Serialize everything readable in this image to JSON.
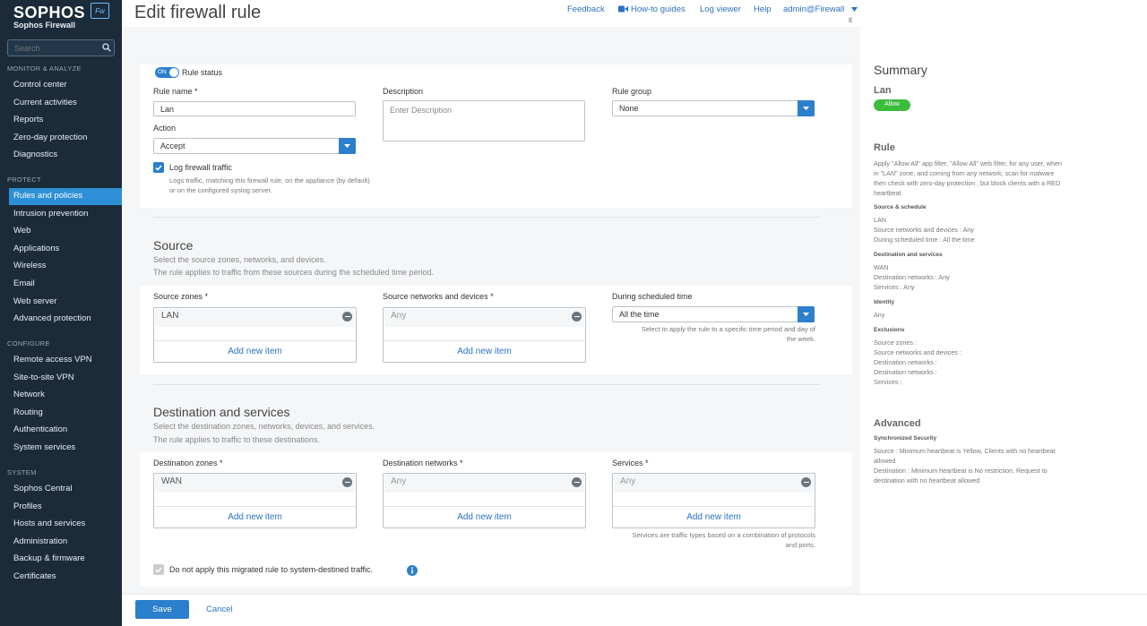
{
  "brand": {
    "logo": "SOPHOS",
    "badge": "Fw",
    "product": "Sophos Firewall"
  },
  "sidebar": {
    "search_placeholder": "Search",
    "sections": [
      {
        "title": "MONITOR & ANALYZE",
        "items": [
          "Control center",
          "Current activities",
          "Reports",
          "Zero-day protection",
          "Diagnostics"
        ]
      },
      {
        "title": "PROTECT",
        "items": [
          "Rules and policies",
          "Intrusion prevention",
          "Web",
          "Applications",
          "Wireless",
          "Email",
          "Web server",
          "Advanced protection"
        ]
      },
      {
        "title": "CONFIGURE",
        "items": [
          "Remote access VPN",
          "Site-to-site VPN",
          "Network",
          "Routing",
          "Authentication",
          "System services"
        ]
      },
      {
        "title": "SYSTEM",
        "items": [
          "Sophos Central",
          "Profiles",
          "Hosts and services",
          "Administration",
          "Backup & firmware",
          "Certificates"
        ]
      }
    ],
    "active_item": "Rules and policies"
  },
  "header": {
    "title": "Edit firewall rule",
    "links": {
      "feedback": "Feedback",
      "howto": "How-to guides",
      "logviewer": "Log viewer",
      "help": "Help",
      "admin": "admin@Firewall"
    },
    "admin_sub": "it"
  },
  "rule": {
    "toggle_label": "ON",
    "status_label": "Rule status",
    "name_label": "Rule name *",
    "name_value": "Lan",
    "description_label": "Description",
    "description_placeholder": "Enter Description",
    "group_label": "Rule group",
    "group_value": "None",
    "action_label": "Action",
    "action_value": "Accept",
    "log_label": "Log firewall traffic",
    "log_help": "Logs traffic, matching this firewall rule, on the appliance (by default) or on the configured syslog server."
  },
  "source": {
    "title": "Source",
    "sub1": "Select the source zones, networks, and devices.",
    "sub2": "The rule applies to traffic from these sources during the scheduled time period.",
    "zones_label": "Source zones *",
    "zones_value": "LAN",
    "networks_label": "Source networks and devices *",
    "networks_value": "Any",
    "schedule_label": "During scheduled time",
    "schedule_value": "All the time",
    "schedule_help": "Select to apply the rule to a specific time period and day of the week.",
    "add_new": "Add new item"
  },
  "destination": {
    "title": "Destination and services",
    "sub1": "Select the destination zones, networks, devices, and services.",
    "sub2": "The rule applies to traffic to these destinations.",
    "zones_label": "Destination zones *",
    "zones_value": "WAN",
    "networks_label": "Destination networks *",
    "networks_value": "Any",
    "services_label": "Services *",
    "services_value": "Any",
    "services_help": "Services are traffic types based on a combination of protocols and ports.",
    "add_new": "Add new item",
    "migrated_label": "Do not apply this migrated rule to system-destined traffic."
  },
  "footer": {
    "save": "Save",
    "cancel": "Cancel"
  },
  "summary": {
    "title": "Summary",
    "rule_name": "Lan",
    "badge": "Allow",
    "rule_heading": "Rule",
    "rule_desc": "Apply \"Allow All\" app filter, \"Allow All\" web filter, for any user, when in \"LAN\" zone, and coming from any network, scan for malware then check with zero-day protection , but block clients with a RED heartbeat",
    "src_heading": "Source & schedule",
    "src_lines": [
      "LAN",
      "Source networks and devices : Any",
      "During scheduled time : All the time"
    ],
    "dst_heading": "Destination and services",
    "dst_lines": [
      "WAN",
      "Destination networks : Any",
      "Services : Any"
    ],
    "identity_heading": "Identity",
    "identity_lines": [
      "Any"
    ],
    "excl_heading": "Exclusions",
    "excl_lines": [
      "Source zones :",
      "Source networks and devices :",
      "Destination networks :",
      "Destination networks :",
      "Services :"
    ],
    "adv_heading": "Advanced",
    "sync_heading": "Synchronized Security",
    "sync_lines": [
      "Source : Minimum heartbeat is Yellow, Clients with no heartbeat allowed",
      "Destination : Minimum heartbeat is No restriction, Request to destination with no heartbeat allowed"
    ]
  }
}
